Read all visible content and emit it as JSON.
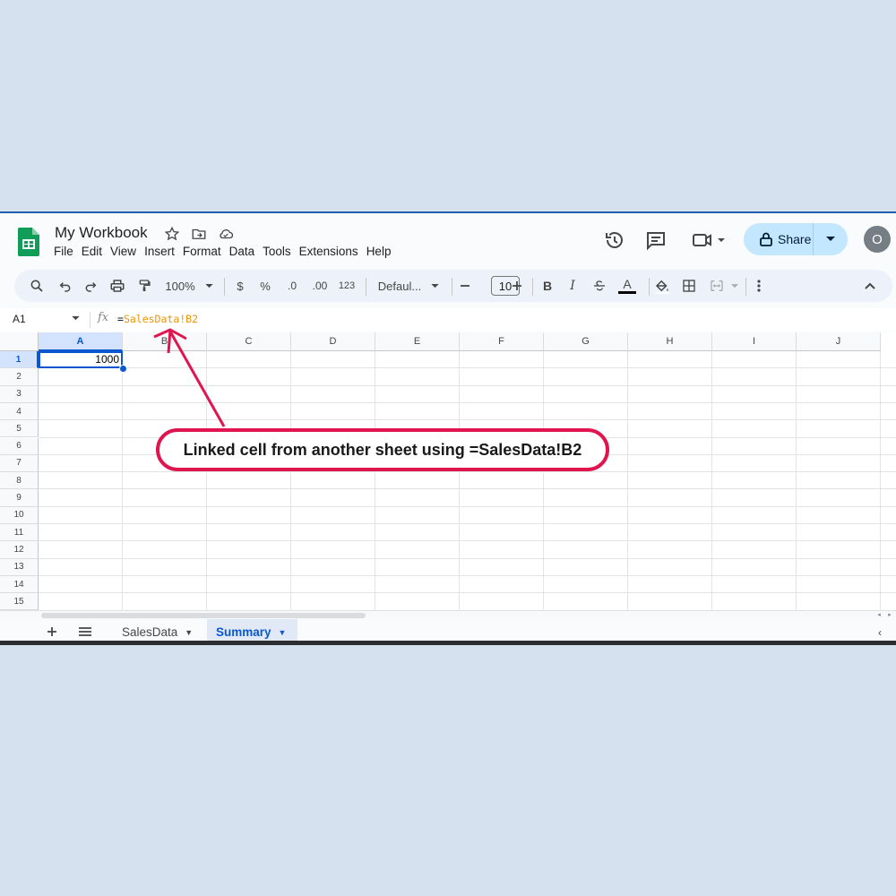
{
  "app": {
    "title": "My Workbook",
    "accent": "#0b57d0",
    "menu": [
      "File",
      "Edit",
      "View",
      "Insert",
      "Format",
      "Data",
      "Tools",
      "Extensions",
      "Help"
    ],
    "share_label": "Share",
    "avatar_initial": "O"
  },
  "toolbar": {
    "zoom": "100%",
    "currency": "$",
    "percent": "%",
    "decrease_decimal": ".0",
    "increase_decimal": ".00",
    "number_format": "123",
    "font": "Defaul...",
    "font_size": "10",
    "bold": "B",
    "italic": "I",
    "text_color": "A"
  },
  "formula_bar": {
    "name_box": "A1",
    "fx": "fx",
    "formula_prefix": "=",
    "formula_ref": "SalesData!B2",
    "ref_color": "#f09300"
  },
  "grid": {
    "columns": [
      "A",
      "B",
      "C",
      "D",
      "E",
      "F",
      "G",
      "H",
      "I",
      "J"
    ],
    "rows": [
      "1",
      "2",
      "3",
      "4",
      "5",
      "6",
      "7",
      "8",
      "9",
      "10",
      "11",
      "12",
      "13",
      "14",
      "15"
    ],
    "selected_cell": "A1",
    "a1_value": "1000"
  },
  "sheets": {
    "tabs": [
      {
        "label": "SalesData",
        "active": false
      },
      {
        "label": "Summary",
        "active": true
      }
    ]
  },
  "annotation": {
    "text": "Linked cell from another sheet using =SalesData!B2",
    "color": "#e0154f"
  }
}
